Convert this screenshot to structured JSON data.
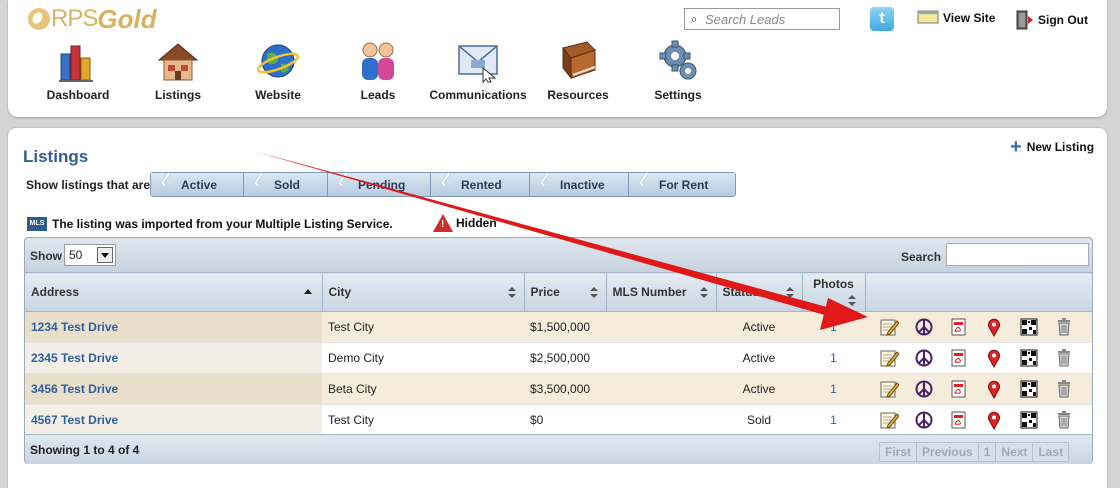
{
  "header": {
    "logo": {
      "prefix": "RPS",
      "suffix": "Gold"
    },
    "nav": [
      {
        "label": "Dashboard",
        "icon": "bar-chart-icon"
      },
      {
        "label": "Listings",
        "icon": "house-icon"
      },
      {
        "label": "Website",
        "icon": "globe-icon"
      },
      {
        "label": "Leads",
        "icon": "people-icon"
      },
      {
        "label": "Communications",
        "icon": "envelope-icon"
      },
      {
        "label": "Resources",
        "icon": "book-icon"
      },
      {
        "label": "Settings",
        "icon": "gear-icon"
      }
    ],
    "search_placeholder": "Search Leads",
    "view_site": "View Site",
    "sign_out": "Sign Out"
  },
  "page": {
    "title": "Listings",
    "new_listing": "New Listing",
    "filter_label": "Show listings that are",
    "filters": [
      "Active",
      "Sold",
      "Pending",
      "Rented",
      "Inactive",
      "For Rent"
    ],
    "mls_badge": "MLS",
    "mls_note": "The listing was imported from your Multiple Listing Service.",
    "hidden_note": "Hidden"
  },
  "table": {
    "show_label": "Show",
    "page_size": "50",
    "search_label": "Search",
    "columns": [
      "Address",
      "City",
      "Price",
      "MLS Number",
      "Status",
      "Photos"
    ],
    "rows": [
      {
        "address": "1234 Test Drive",
        "city": "Test City",
        "price": "$1,500,000",
        "mls": "",
        "status": "Active",
        "photos": "1"
      },
      {
        "address": "2345 Test Drive",
        "city": "Demo City",
        "price": "$2,500,000",
        "mls": "",
        "status": "Active",
        "photos": "1"
      },
      {
        "address": "3456 Test Drive",
        "city": "Beta City",
        "price": "$3,500,000",
        "mls": "",
        "status": "Active",
        "photos": "1"
      },
      {
        "address": "4567 Test Drive",
        "city": "Test City",
        "price": "$0",
        "mls": "",
        "status": "Sold",
        "photos": "1"
      }
    ],
    "row_actions": [
      "edit-icon",
      "peace-icon",
      "pdf-icon",
      "map-pin-icon",
      "qr-code-icon",
      "trash-icon"
    ],
    "showing": "Showing 1 to 4 of 4",
    "pager": [
      "First",
      "Previous",
      "1",
      "Next",
      "Last"
    ]
  },
  "colors": {
    "accent": "#345c8f",
    "arrow": "#e01818",
    "logo": "#d8b264"
  }
}
